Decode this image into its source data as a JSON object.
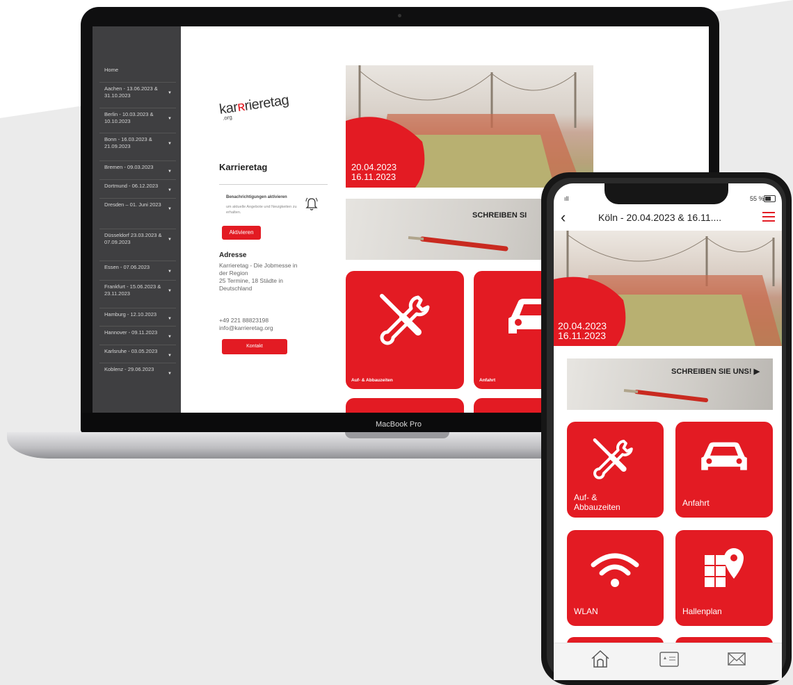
{
  "colors": {
    "accent": "#e31b23",
    "sidebar": "#3f3f41",
    "background": "#ebebeb"
  },
  "laptop": {
    "brand": "MacBook Pro",
    "sidebar": {
      "items": [
        {
          "label": "Home",
          "caret": false
        },
        {
          "label": "Aachen - 13.06.2023 & 31.10.2023",
          "caret": true
        },
        {
          "label": "Berlin - 10.03.2023 & 10.10.2023",
          "caret": true
        },
        {
          "label": "Bonn - 16.03.2023 & 21.09.2023",
          "caret": true
        },
        {
          "label": "Bremen - 09.03.2023",
          "caret": true
        },
        {
          "label": "Dortmund - 06.12.2023",
          "caret": true
        },
        {
          "label": "Dresden – 01. Juni 2023",
          "caret": true
        },
        {
          "label": "Düsseldorf 23.03.2023 & 07.09.2023",
          "caret": true
        },
        {
          "label": "Essen - 07.06.2023",
          "caret": true
        },
        {
          "label": "Frankfurt - 15.06.2023 & 23.11.2023",
          "caret": true
        },
        {
          "label": "Hamburg - 12.10.2023",
          "caret": true
        },
        {
          "label": "Hannover - 09.11.2023",
          "caret": true
        },
        {
          "label": "Karlsruhe - 03.05.2023",
          "caret": true
        },
        {
          "label": "Koblenz - 29.06.2023",
          "caret": true
        }
      ]
    },
    "logo": {
      "text_a": "kar",
      "text_b": "rieretag",
      "suffix": ".org"
    },
    "side": {
      "title": "Karrieretag",
      "notif_heading": "Benachrichtigungen aktivieren",
      "notif_text": "um aktuelle Angebote und Neuigkeiten zu erhalten.",
      "activate_label": "Aktivieren",
      "address_heading": "Adresse",
      "address_lines": [
        "Karrieretag - Die Jobmesse in",
        "der Region",
        "25 Termine, 18 Städte in",
        "Deutschland"
      ],
      "phone": "+49 221 88823198",
      "email": "info@karrieretag.org",
      "contact_label": "Kontakt"
    },
    "hero": {
      "date1": "20.04.2023",
      "date2": "16.11.2023"
    },
    "banner": {
      "text": "SCHREIBEN SI"
    },
    "tiles": [
      {
        "label": "Auf- & Abbauzeiten",
        "icon": "tools-icon"
      },
      {
        "label": "Anfahrt",
        "icon": "car-icon"
      }
    ]
  },
  "phone": {
    "status": {
      "signal": "ıll",
      "battery": "55 %"
    },
    "title": "Köln  -  20.04.2023 & 16.11....",
    "hero": {
      "date1": "20.04.2023",
      "date2": "16.11.2023"
    },
    "banner": {
      "text": "SCHREIBEN SIE UNS! ▶"
    },
    "tiles": [
      {
        "label": "Auf- &\nAbbauzeiten",
        "icon": "tools-icon"
      },
      {
        "label": "Anfahrt",
        "icon": "car-icon"
      },
      {
        "label": "WLAN",
        "icon": "wifi-icon"
      },
      {
        "label": "Hallenplan",
        "icon": "floor-plan-icon"
      }
    ],
    "bottom_nav": [
      "home-icon",
      "card-icon",
      "mail-icon"
    ]
  }
}
